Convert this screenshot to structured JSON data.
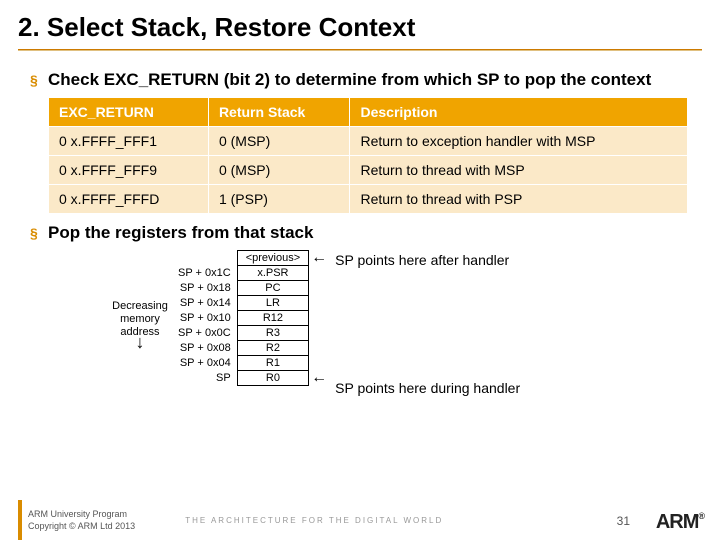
{
  "title": "2. Select Stack, Restore Context",
  "bullets": {
    "b1": "Check EXC_RETURN (bit 2) to determine from which SP to pop the context",
    "b2": "Pop the registers from that stack"
  },
  "table": {
    "h0": "EXC_RETURN",
    "h1": "Return Stack",
    "h2": "Description",
    "r0c0": "0 x.FFFF_FFF1",
    "r0c1": "0 (MSP)",
    "r0c2": "Return to exception handler with MSP",
    "r1c0": "0 x.FFFF_FFF9",
    "r1c1": "0 (MSP)",
    "r1c2": "Return to thread with MSP",
    "r2c0": "0 x.FFFF_FFFD",
    "r2c1": "1 (PSP)",
    "r2c2": "Return to thread with PSP"
  },
  "mem": {
    "label1": "Decreasing",
    "label2": "memory",
    "label3": "address"
  },
  "stack": {
    "prev": "<previous>",
    "a7": "SP + 0x1C",
    "v7": "x.PSR",
    "a6": "SP + 0x18",
    "v6": "PC",
    "a5": "SP + 0x14",
    "v5": "LR",
    "a4": "SP + 0x10",
    "v4": "R12",
    "a3": "SP + 0x0C",
    "v3": "R3",
    "a2": "SP + 0x08",
    "v2": "R2",
    "a1": "SP + 0x04",
    "v1": "R1",
    "a0": "SP",
    "v0": "R0"
  },
  "ann": {
    "after": "SP points here after handler",
    "during": "SP points here during handler"
  },
  "footer": {
    "line1": "ARM University Program",
    "line2": "Copyright © ARM Ltd 2013",
    "tagline": "THE ARCHITECTURE FOR THE DIGITAL WORLD",
    "page": "31",
    "logo": "ARM"
  }
}
